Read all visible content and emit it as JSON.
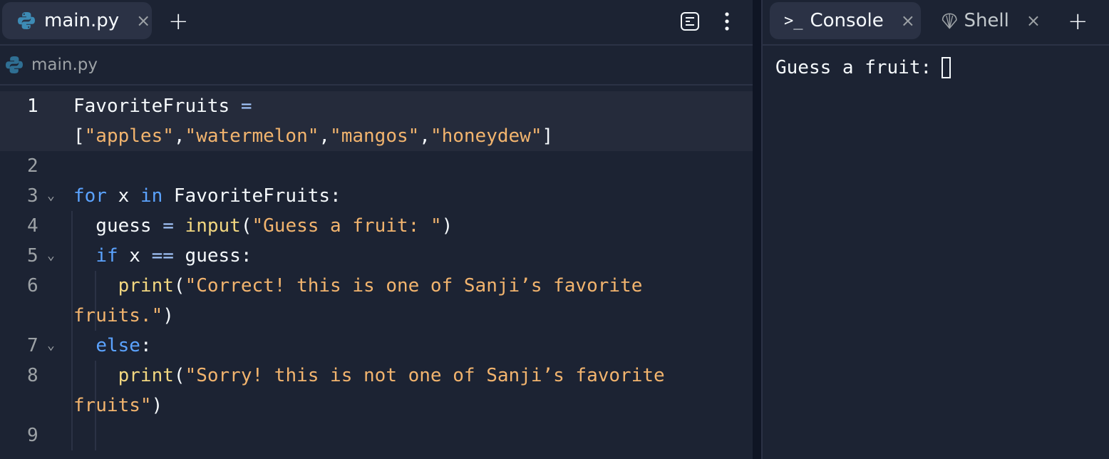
{
  "editor": {
    "tabs": [
      {
        "label": "main.py",
        "icon": "python-icon",
        "active": true,
        "close": "×"
      }
    ],
    "new_tab_label": "+",
    "breadcrumb": {
      "icon": "python-icon",
      "label": "main.py"
    },
    "toolbar": {
      "outline_icon": "outline-icon",
      "more_icon": "more-vertical-icon"
    },
    "lines": [
      {
        "num": "1",
        "fold": "",
        "current": true,
        "rows": [
          [
            {
              "t": "FavoriteFruits ",
              "c": ""
            },
            {
              "t": "=",
              "c": "op"
            }
          ],
          [
            {
              "t": "[",
              "c": ""
            },
            {
              "t": "\"apples\"",
              "c": "str"
            },
            {
              "t": ",",
              "c": ""
            },
            {
              "t": "\"watermelon\"",
              "c": "str"
            },
            {
              "t": ",",
              "c": ""
            },
            {
              "t": "\"mangos\"",
              "c": "str"
            },
            {
              "t": ",",
              "c": ""
            },
            {
              "t": "\"honeydew\"",
              "c": "str"
            },
            {
              "t": "]",
              "c": ""
            }
          ]
        ]
      },
      {
        "num": "2",
        "fold": "",
        "rows": [
          [
            {
              "t": "",
              "c": ""
            }
          ]
        ]
      },
      {
        "num": "3",
        "fold": "⌄",
        "rows": [
          [
            {
              "t": "for",
              "c": "kw"
            },
            {
              "t": " x ",
              "c": ""
            },
            {
              "t": "in",
              "c": "kw"
            },
            {
              "t": " FavoriteFruits:",
              "c": ""
            }
          ]
        ]
      },
      {
        "num": "4",
        "fold": "",
        "rows": [
          [
            {
              "t": "  guess ",
              "c": ""
            },
            {
              "t": "=",
              "c": "op"
            },
            {
              "t": " ",
              "c": ""
            },
            {
              "t": "input",
              "c": "fn"
            },
            {
              "t": "(",
              "c": ""
            },
            {
              "t": "\"Guess a fruit: \"",
              "c": "str"
            },
            {
              "t": ")",
              "c": ""
            }
          ]
        ]
      },
      {
        "num": "5",
        "fold": "⌄",
        "rows": [
          [
            {
              "t": "  ",
              "c": ""
            },
            {
              "t": "if",
              "c": "kw"
            },
            {
              "t": " x ",
              "c": ""
            },
            {
              "t": "==",
              "c": "op"
            },
            {
              "t": " guess:",
              "c": ""
            }
          ]
        ]
      },
      {
        "num": "6",
        "fold": "",
        "rows": [
          [
            {
              "t": "    ",
              "c": ""
            },
            {
              "t": "print",
              "c": "fn"
            },
            {
              "t": "(",
              "c": ""
            },
            {
              "t": "\"Correct! this is one of Sanji’s favorite",
              "c": "str"
            }
          ],
          [
            {
              "t": "fruits.\"",
              "c": "str"
            },
            {
              "t": ")",
              "c": ""
            }
          ]
        ]
      },
      {
        "num": "7",
        "fold": "⌄",
        "rows": [
          [
            {
              "t": "  ",
              "c": ""
            },
            {
              "t": "else",
              "c": "kw"
            },
            {
              "t": ":",
              "c": ""
            }
          ]
        ]
      },
      {
        "num": "8",
        "fold": "",
        "rows": [
          [
            {
              "t": "    ",
              "c": ""
            },
            {
              "t": "print",
              "c": "fn"
            },
            {
              "t": "(",
              "c": ""
            },
            {
              "t": "\"Sorry! this is not one of Sanji’s favorite",
              "c": "str"
            }
          ],
          [
            {
              "t": "fruits\"",
              "c": "str"
            },
            {
              "t": ")",
              "c": ""
            }
          ]
        ]
      },
      {
        "num": "9",
        "fold": "",
        "rows": [
          [
            {
              "t": "",
              "c": ""
            }
          ]
        ]
      }
    ]
  },
  "console": {
    "tabs": [
      {
        "label": "Console",
        "icon": "terminal-prompt-icon",
        "glyph": ">_",
        "active": true,
        "close": "×"
      },
      {
        "label": "Shell",
        "icon": "shell-icon",
        "active": false,
        "close": "×"
      }
    ],
    "new_tab_label": "+",
    "output": "Guess a fruit:"
  }
}
